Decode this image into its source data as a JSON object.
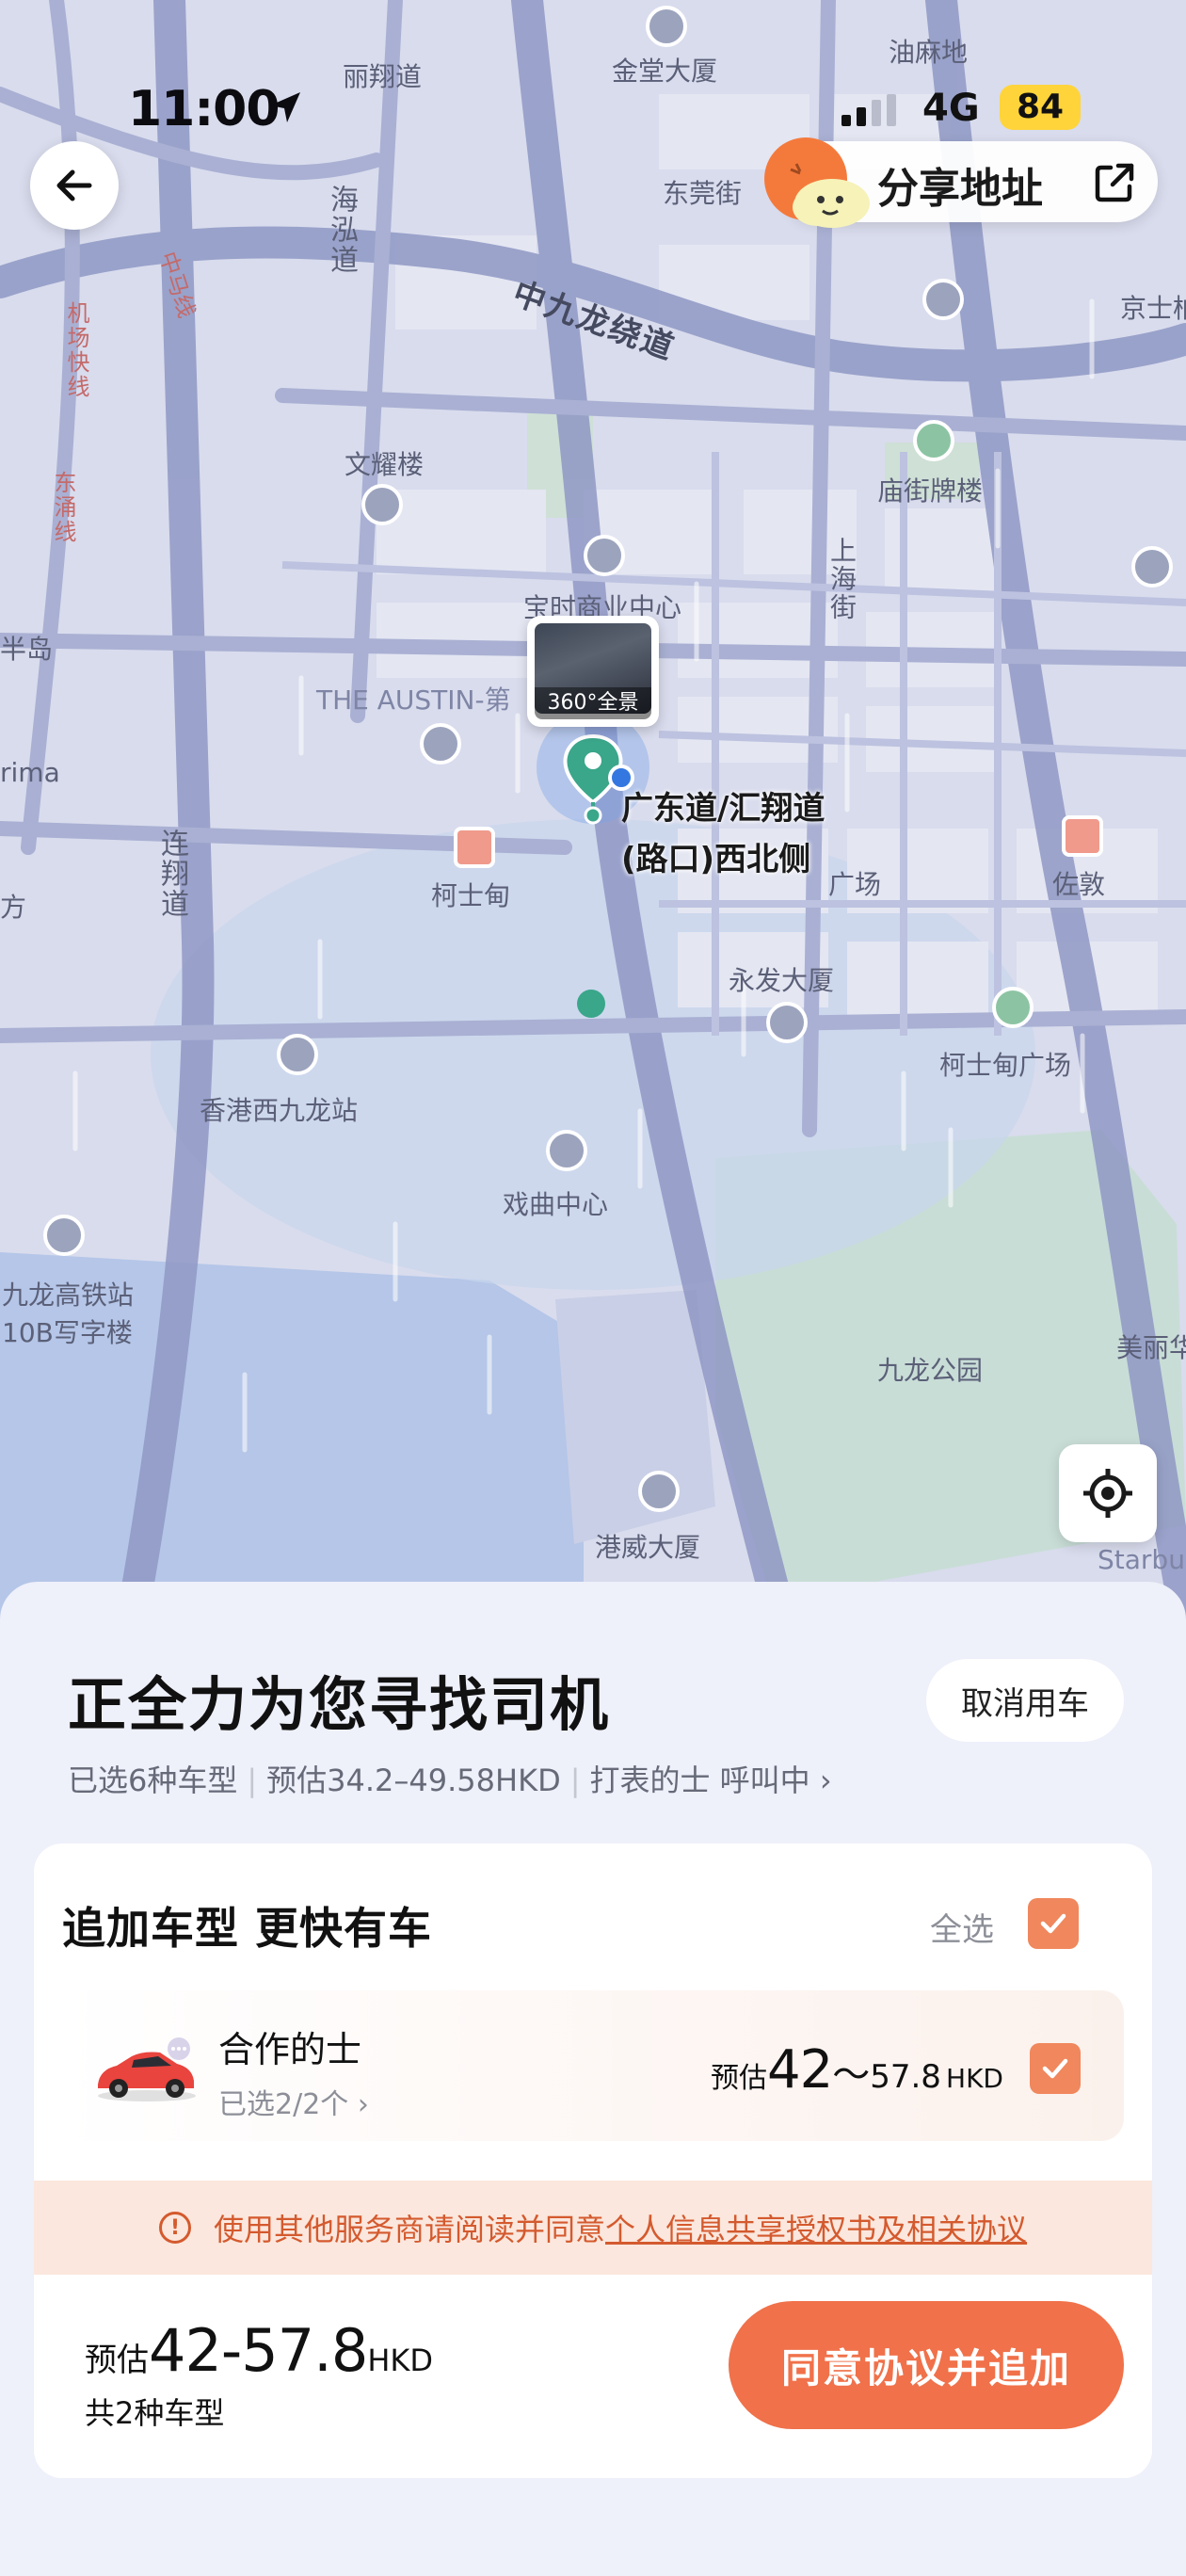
{
  "status_bar": {
    "time": "11:00",
    "network": "4G",
    "battery": "84"
  },
  "header": {
    "share_label": "分享地址"
  },
  "map": {
    "labels": {
      "lixiang_road": "丽翔道",
      "jintang": "金堂大厦",
      "youma": "油麻地",
      "haihong": "海泓道",
      "dongguan": "东莞街",
      "zhongma": "中马线",
      "airport_express": "机场快线",
      "tung_chung": "东涌线",
      "bypass": "中九龙绕道",
      "jingshi": "京士柏",
      "wenyao": "文耀楼",
      "miaojie": "庙街牌楼",
      "shanghai_st": "上海街",
      "commercial": "宝时商业中心",
      "austin": "THE AUSTIN-第",
      "kesd": "柯士甸",
      "lianxiang": "连翔道",
      "hk_west_kowloon": "香港西九龙站",
      "yongfa": "永发大厦",
      "jordan": "佐敦",
      "ksd_square": "柯士甸广场",
      "xiqu": "戏曲中心",
      "hsr": "九龙高铁站",
      "office": "10B写字楼",
      "kowloon_park": "九龙公园",
      "meili": "美丽华",
      "ganwei": "港威大厦",
      "starbu": "Starbu",
      "banddao": "半岛",
      "rima": "rima",
      "fang": "方",
      "plaza": "广场"
    },
    "pano_label": "360°全景",
    "pickup_line1": "广东道/汇翔道",
    "pickup_line2": "(路口)西北侧"
  },
  "sheet": {
    "title": "正全力为您寻找司机",
    "cancel_label": "取消用车",
    "sub_selected": "已选6种车型",
    "sub_estimate": "预估34.2–49.58HKD",
    "sub_status": "打表的士 呼叫中 ›"
  },
  "add_card": {
    "title": "追加车型 更快有车",
    "select_all_label": "全选",
    "option": {
      "name": "合作的士",
      "sub": "已选2/2个 ›",
      "price_prefix": "预估",
      "price_low": "42",
      "price_sep": "～",
      "price_high": "57.8",
      "currency": "HKD"
    }
  },
  "notice": {
    "text": "使用其他服务商请阅读并同意",
    "link": "个人信息共享授权书及相关协议"
  },
  "bottom": {
    "price_prefix": "预估",
    "price_range": "42-57.8",
    "currency": "HKD",
    "count": "共2种车型",
    "confirm_label": "同意协议并追加"
  },
  "colors": {
    "accent": "#f0714a",
    "checkbox": "#f0875d",
    "map_bg": "#d9dced",
    "route": "#7f8ab8",
    "pin": "#3aa68a",
    "notice_bg": "#fbe7dd"
  },
  "icons": [
    "location-arrow-icon",
    "back-arrow-icon",
    "share-icon",
    "locate-icon",
    "check-icon",
    "warning-icon",
    "car-icon",
    "pickup-pin-icon"
  ]
}
